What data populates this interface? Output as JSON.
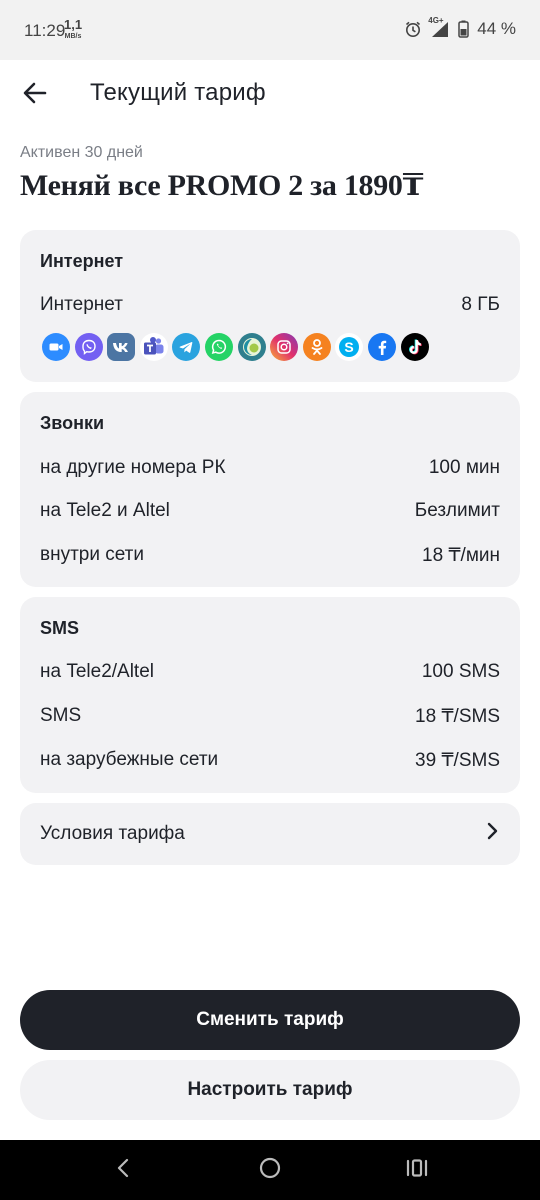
{
  "status_bar": {
    "time": "11:29",
    "speed_value": "1,1",
    "speed_unit": "MB/s",
    "network": "4G+",
    "battery": "44 %"
  },
  "header": {
    "title": "Текущий тариф"
  },
  "plan": {
    "status": "Активен 30 дней",
    "name": "Меняй все PROMO 2 за 1890₸"
  },
  "internet": {
    "title": "Интернет",
    "rows": [
      {
        "label": "Интернет",
        "value": "8 ГБ"
      }
    ],
    "apps": [
      "zoom-icon",
      "viber-icon",
      "vk-icon",
      "teams-icon",
      "telegram-icon",
      "whatsapp-icon",
      "imo-icon",
      "instagram-icon",
      "odnoklassniki-icon",
      "skype-icon",
      "facebook-icon",
      "tiktok-icon"
    ]
  },
  "calls": {
    "title": "Звонки",
    "rows": [
      {
        "label": "на другие номера РК",
        "value": "100 мин"
      },
      {
        "label": "на Tele2 и Altel",
        "value": "Безлимит"
      },
      {
        "label": "внутри сети",
        "value": "18 ₸/мин"
      }
    ]
  },
  "sms": {
    "title": "SMS",
    "rows": [
      {
        "label": "на Tele2/Altel",
        "value": "100 SMS"
      },
      {
        "label": "SMS",
        "value": "18 ₸/SMS"
      },
      {
        "label": "на зарубежные сети",
        "value": "39 ₸/SMS"
      }
    ]
  },
  "conditions": {
    "label": "Условия тарифа"
  },
  "actions": {
    "change_label": "Сменить тариф",
    "configure_label": "Настроить тариф"
  },
  "colors": {
    "primary": "#1f2229",
    "card_bg": "#f2f2f4",
    "muted_text": "#7a7e86"
  }
}
